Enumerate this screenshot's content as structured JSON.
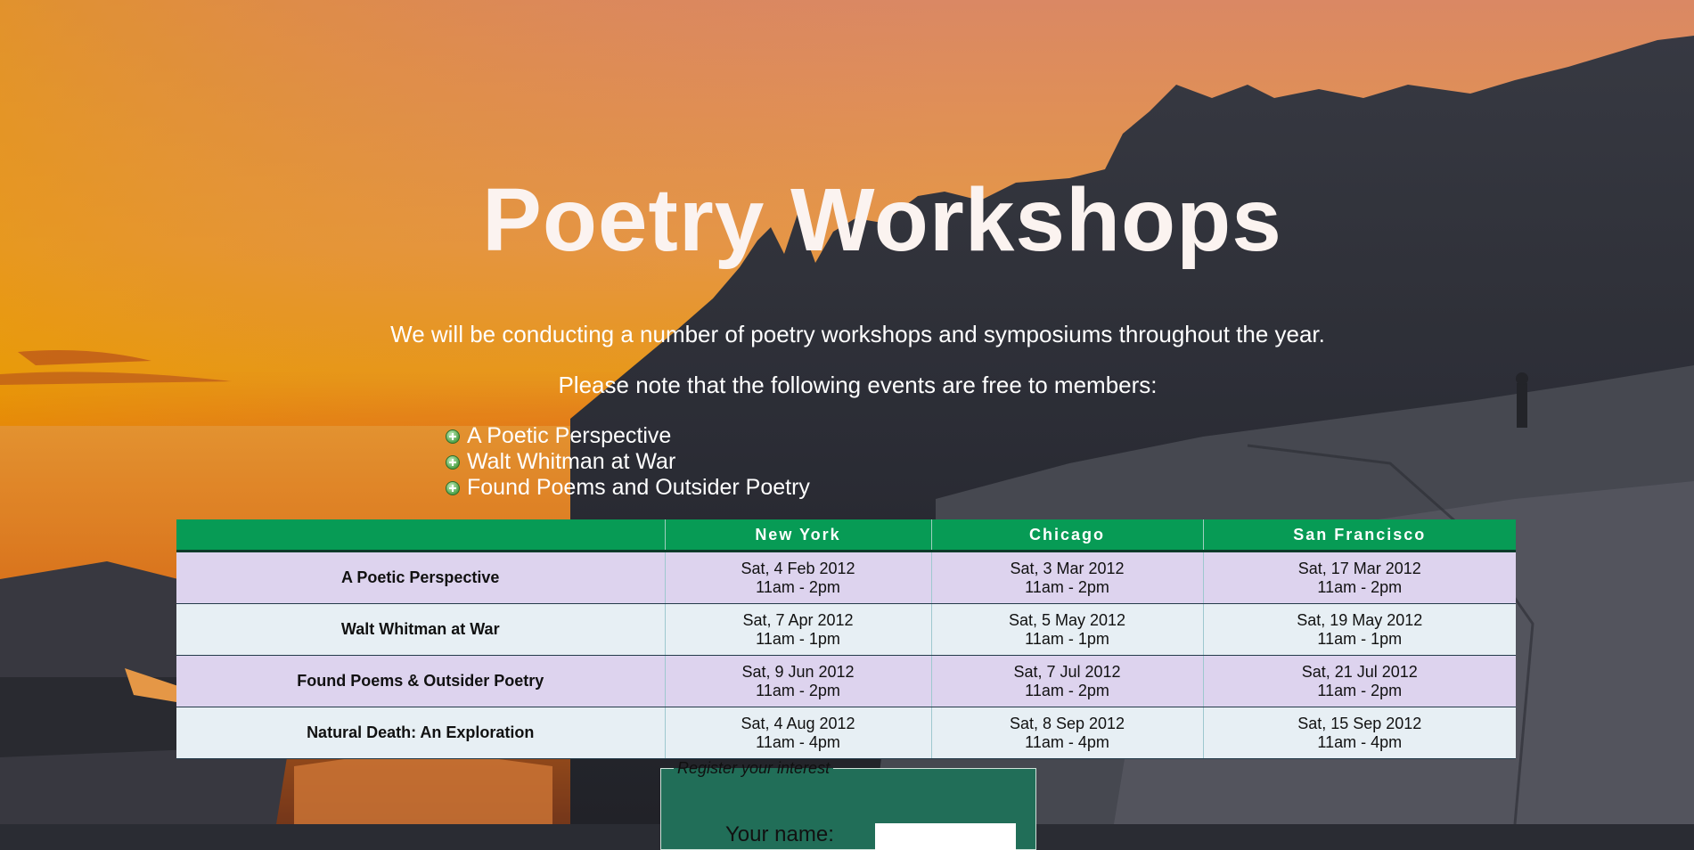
{
  "page": {
    "title": "Poetry Workshops",
    "intro_line_1": "We will be conducting a number of poetry workshops and symposiums throughout the year.",
    "intro_line_2": "Please note that the following events are free to members:"
  },
  "free_events": [
    "A Poetic Perspective",
    "Walt Whitman at War",
    "Found Poems and Outsider Poetry"
  ],
  "schedule": {
    "headers": [
      "",
      "New York",
      "Chicago",
      "San Francisco"
    ],
    "rows": [
      {
        "event": "A Poetic Perspective",
        "cells": [
          [
            "Sat, 4 Feb 2012",
            "11am - 2pm"
          ],
          [
            "Sat, 3 Mar 2012",
            "11am - 2pm"
          ],
          [
            "Sat, 17 Mar 2012",
            "11am - 2pm"
          ]
        ]
      },
      {
        "event": "Walt Whitman at War",
        "cells": [
          [
            "Sat, 7 Apr 2012",
            "11am - 1pm"
          ],
          [
            "Sat, 5 May 2012",
            "11am - 1pm"
          ],
          [
            "Sat, 19 May 2012",
            "11am - 1pm"
          ]
        ]
      },
      {
        "event": "Found Poems & Outsider Poetry",
        "cells": [
          [
            "Sat, 9 Jun 2012",
            "11am - 2pm"
          ],
          [
            "Sat, 7 Jul 2012",
            "11am - 2pm"
          ],
          [
            "Sat, 21 Jul 2012",
            "11am - 2pm"
          ]
        ]
      },
      {
        "event": "Natural Death: An Exploration",
        "cells": [
          [
            "Sat, 4 Aug 2012",
            "11am - 4pm"
          ],
          [
            "Sat, 8 Sep 2012",
            "11am - 4pm"
          ],
          [
            "Sat, 15 Sep 2012",
            "11am - 4pm"
          ]
        ]
      }
    ]
  },
  "register": {
    "legend": "Register your interest",
    "name_label": "Your name:",
    "name_value": ""
  },
  "colors": {
    "header_green": "#079b55",
    "row_lavender": "#ddd3ee",
    "row_light": "#e7eff4",
    "form_bg": "#216e58"
  }
}
